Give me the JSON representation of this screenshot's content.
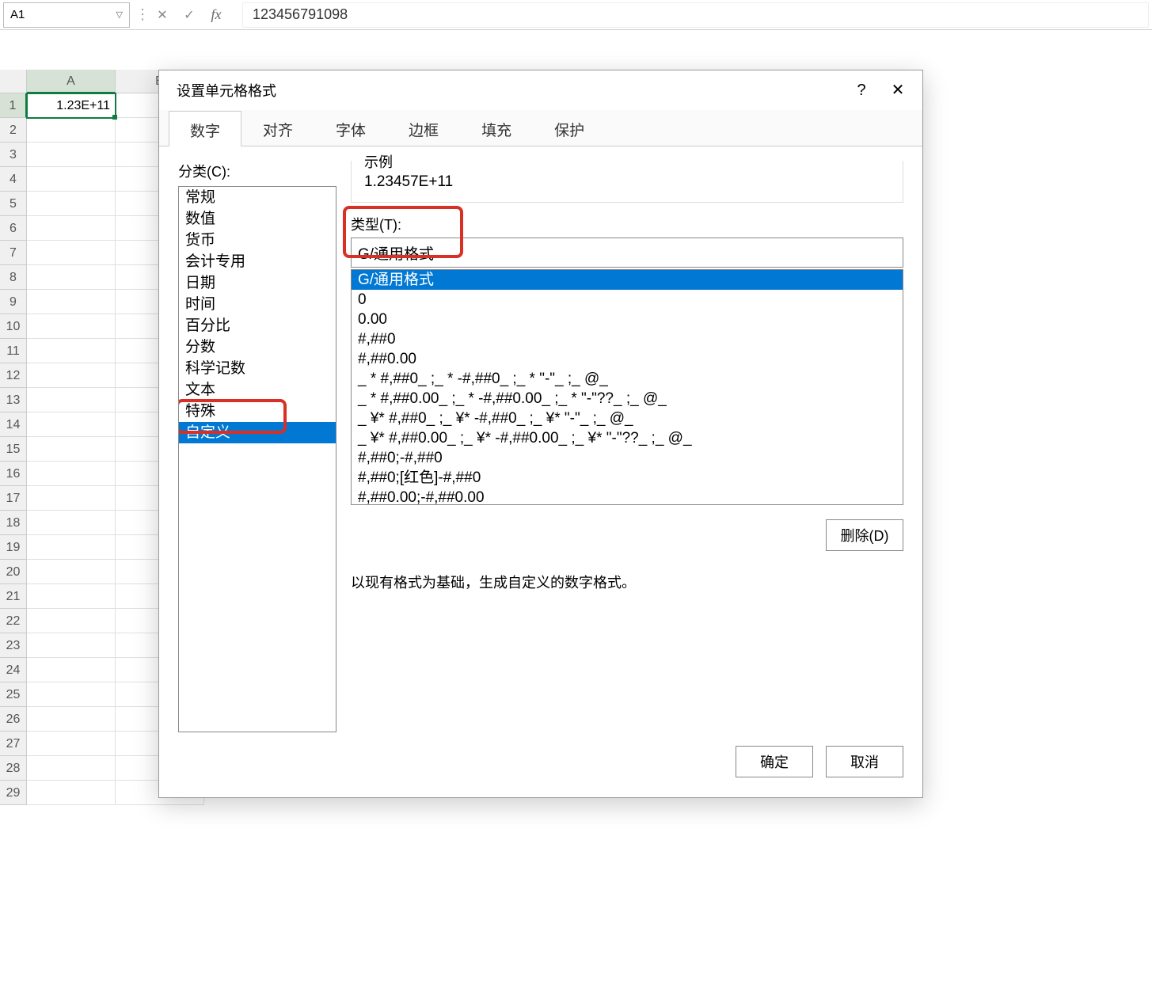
{
  "formula_bar": {
    "name_box": "A1",
    "formula_value": "123456791098"
  },
  "grid": {
    "col_headers": [
      "A",
      "B"
    ],
    "row_count": 29,
    "active_cell_value": "1.23E+11"
  },
  "dialog": {
    "title": "设置单元格格式",
    "tabs": [
      "数字",
      "对齐",
      "字体",
      "边框",
      "填充",
      "保护"
    ],
    "active_tab_index": 0,
    "category_label": "分类(C):",
    "categories": [
      "常规",
      "数值",
      "货币",
      "会计专用",
      "日期",
      "时间",
      "百分比",
      "分数",
      "科学记数",
      "文本",
      "特殊",
      "自定义"
    ],
    "selected_category_index": 11,
    "sample_label": "示例",
    "sample_value": "1.23457E+11",
    "type_label": "类型(T):",
    "type_input_value": "G/通用格式",
    "format_list": [
      "G/通用格式",
      "0",
      "0.00",
      "#,##0",
      "#,##0.00",
      "_ * #,##0_ ;_ * -#,##0_ ;_ * \"-\"_ ;_ @_",
      "_ * #,##0.00_ ;_ * -#,##0.00_ ;_ * \"-\"??_ ;_ @_",
      "_ ¥* #,##0_ ;_ ¥* -#,##0_ ;_ ¥* \"-\"_ ;_ @_",
      "_ ¥* #,##0.00_ ;_ ¥* -#,##0.00_ ;_ ¥* \"-\"??_ ;_ @_",
      "#,##0;-#,##0",
      "#,##0;[红色]-#,##0",
      "#,##0.00;-#,##0.00"
    ],
    "selected_format_index": 0,
    "delete_button": "删除(D)",
    "hint": "以现有格式为基础，生成自定义的数字格式。",
    "ok_button": "确定",
    "cancel_button": "取消"
  }
}
